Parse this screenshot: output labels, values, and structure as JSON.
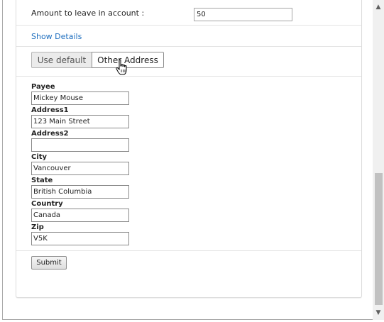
{
  "amount": {
    "label": "Amount to leave in account :",
    "value": "50"
  },
  "details": {
    "link_label": "Show Details"
  },
  "address_tabs": [
    {
      "label": "Use default",
      "selected": false
    },
    {
      "label": "Other Address",
      "selected": true
    }
  ],
  "form": {
    "payee": {
      "label": "Payee",
      "value": "Mickey Mouse"
    },
    "address1": {
      "label": "Address1",
      "value": "123 Main Street"
    },
    "address2": {
      "label": "Address2",
      "value": ""
    },
    "city": {
      "label": "City",
      "value": "Vancouver"
    },
    "state": {
      "label": "State",
      "value": "British Columbia"
    },
    "country": {
      "label": "Country",
      "value": "Canada"
    },
    "zip": {
      "label": "Zip",
      "value": "V5K"
    }
  },
  "submit_label": "Submit",
  "icons": {
    "cursor": "hand-pointer-icon",
    "scroll_up": "scroll-up-arrow-icon",
    "scroll_down": "scroll-down-arrow-icon"
  },
  "colors": {
    "link": "#1f6fbf",
    "tab_inactive_bg": "#ebebeb",
    "scroll_thumb": "#c1c1c1"
  }
}
